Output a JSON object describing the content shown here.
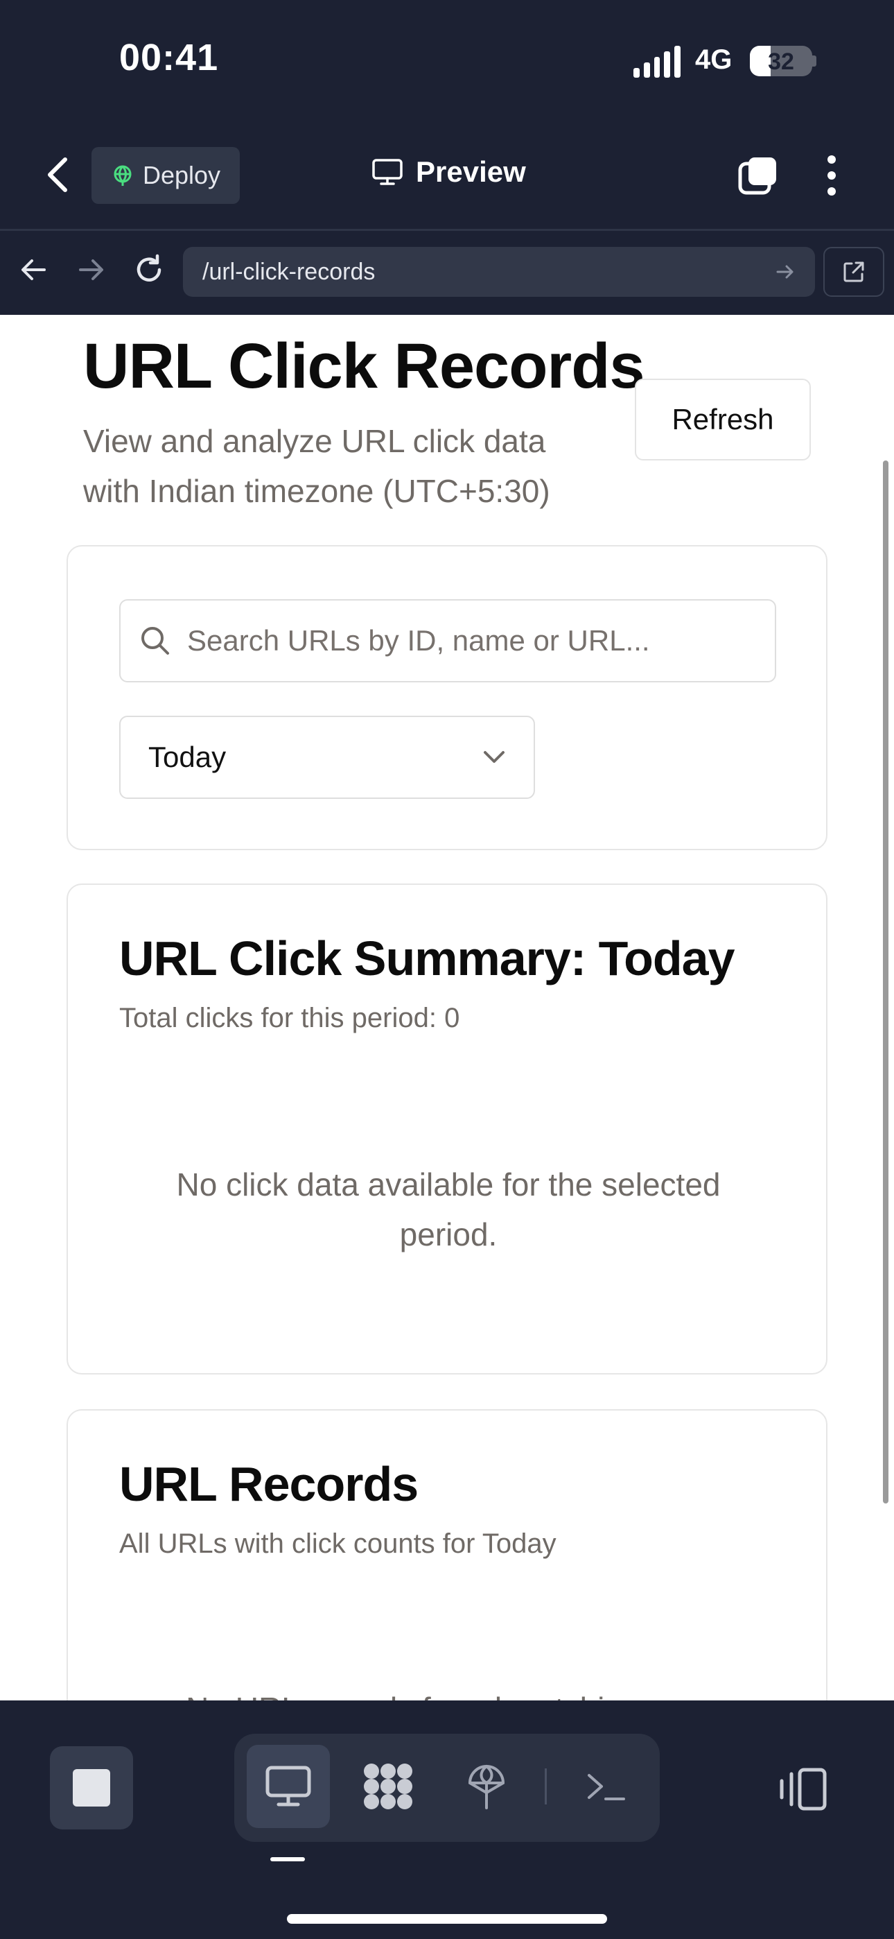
{
  "status_bar": {
    "time": "00:41",
    "network": "4G",
    "battery": "32"
  },
  "app_header": {
    "deploy_label": "Deploy",
    "preview_label": "Preview"
  },
  "browser": {
    "url": "/url-click-records"
  },
  "page": {
    "title": "URL Click Records",
    "subtitle": "View and analyze URL click data with Indian timezone (UTC+5:30)",
    "refresh_label": "Refresh",
    "search": {
      "placeholder": "Search URLs by ID, name or URL..."
    },
    "period_select": {
      "value": "Today"
    },
    "summary": {
      "title": "URL Click Summary: Today",
      "total_clicks": "Total clicks for this period: 0",
      "empty_message": "No click data available for the selected period."
    },
    "records": {
      "title": "URL Records",
      "description": "All URLs with click counts for Today",
      "empty_message": "No URL records found matching your"
    }
  },
  "colors": {
    "chrome_bg": "#1c2133",
    "url_bar_bg": "#323849",
    "deploy_bg": "#303748",
    "deploy_icon": "#4ade80",
    "muted_text": "#6f6a66"
  },
  "icons": {
    "back": "chevron-left-icon",
    "deploy": "globe-icon",
    "preview": "monitor-icon",
    "tabs": "tabs-icon",
    "more": "more-vertical-icon",
    "nav_back": "arrow-left-icon",
    "nav_forward": "arrow-right-icon",
    "reload": "reload-icon",
    "go": "arrow-right-icon",
    "external": "external-link-icon",
    "search": "search-icon",
    "dropdown": "chevron-down-icon",
    "stop": "stop-icon",
    "toolbar": [
      "monitor-icon",
      "apps-icon",
      "deploy-icon",
      "terminal-icon"
    ],
    "devices": "devices-icon"
  }
}
